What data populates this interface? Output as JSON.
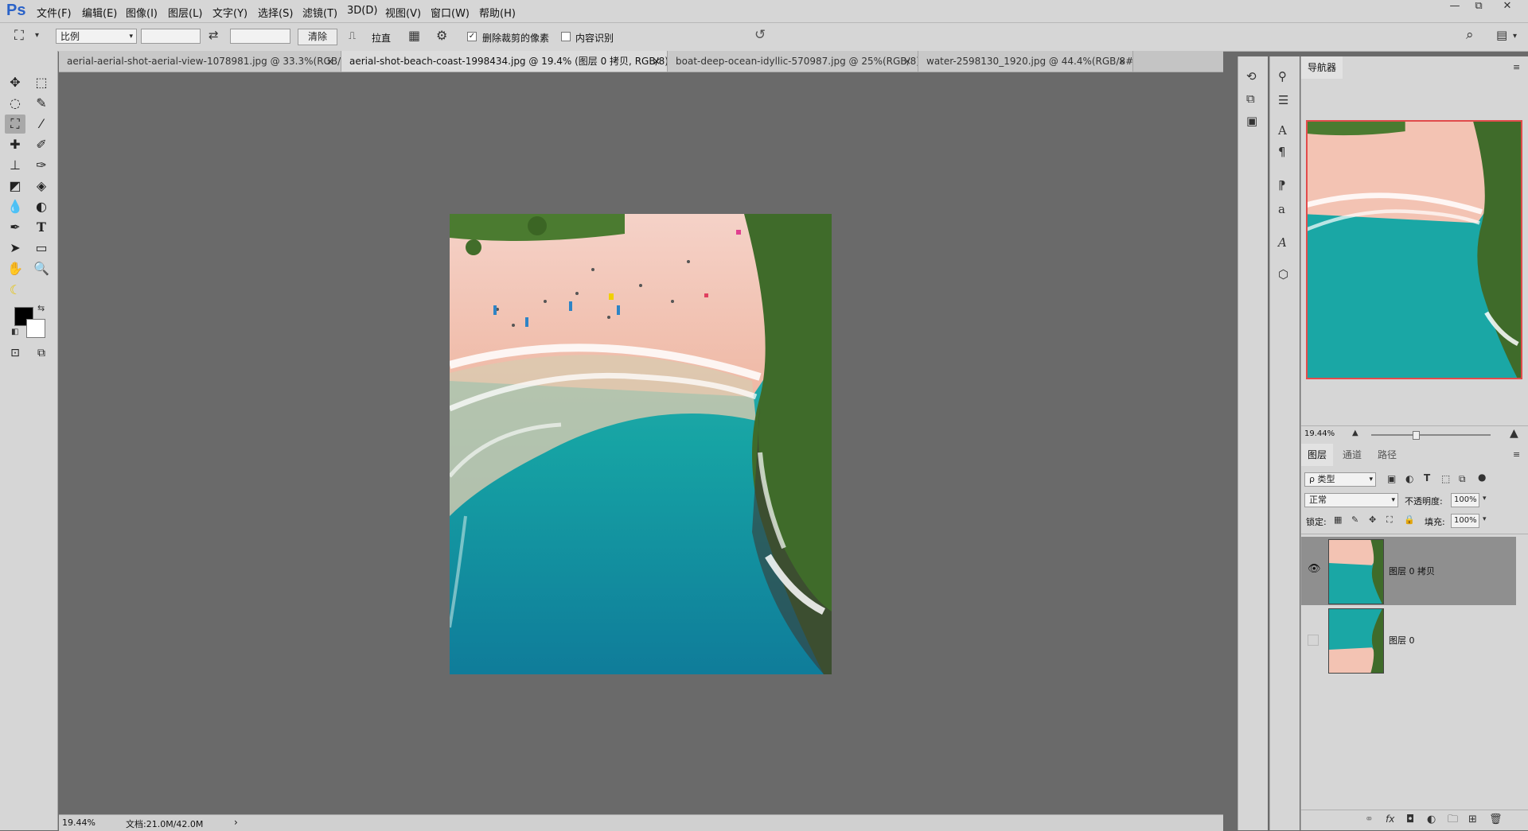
{
  "app": {
    "logo": "Ps"
  },
  "menu": [
    "文件(F)",
    "编辑(E)",
    "图像(I)",
    "图层(L)",
    "文字(Y)",
    "选择(S)",
    "滤镜(T)",
    "3D(D)",
    "视图(V)",
    "窗口(W)",
    "帮助(H)"
  ],
  "window_controls": {
    "minimize": "—",
    "restore": "⧉",
    "close": "✕"
  },
  "options": {
    "ratio_select": "比例",
    "clear_label": "清除",
    "straighten_label": "拉直",
    "delete_cropped_label": "删除裁剪的像素",
    "delete_cropped_checked": true,
    "content_aware_label": "内容识别",
    "content_aware_checked": false
  },
  "tabs": [
    {
      "label": "aerial-aerial-shot-aerial-view-1078981.jpg @ 33.3%(RGB/8)",
      "active": false,
      "close": "×"
    },
    {
      "label": "aerial-shot-beach-coast-1998434.jpg @ 19.4% (图层 0 拷贝, RGB/8) *",
      "active": true,
      "close": "×"
    },
    {
      "label": "boat-deep-ocean-idyllic-570987.jpg @ 25%(RGB/8)",
      "active": false,
      "close": "×"
    },
    {
      "label": "water-2598130_1920.jpg @ 44.4%(RGB/8#)",
      "active": false,
      "close": "×"
    }
  ],
  "status": {
    "zoom": "19.44%",
    "doc": "文档:21.0M/42.0M",
    "arrow": "›"
  },
  "navigator": {
    "title": "导航器",
    "zoom": "19.44%"
  },
  "layers_panel": {
    "tabs": [
      "图层",
      "通道",
      "路径"
    ],
    "filter_kind": "ρ 类型",
    "blend_mode": "正常",
    "opacity_label": "不透明度:",
    "opacity_value": "100%",
    "lock_label": "锁定:",
    "fill_label": "填充:",
    "fill_value": "100%",
    "layers": [
      {
        "name": "图层 0 拷贝",
        "visible": true,
        "selected": true
      },
      {
        "name": "图层 0",
        "visible": false,
        "selected": false
      }
    ],
    "footer_icons": [
      "link-icon",
      "fx-icon",
      "mask-icon",
      "adjustment-icon",
      "group-icon",
      "new-layer-icon",
      "trash-icon"
    ],
    "fx_label": "fx"
  },
  "colors": {
    "accent_blue": "#2a62c8",
    "nav_frame": "#e24b4b",
    "sand": "#f3c3b3",
    "ocean": "#1aa7a5",
    "foliage": "#3f6b2a"
  }
}
